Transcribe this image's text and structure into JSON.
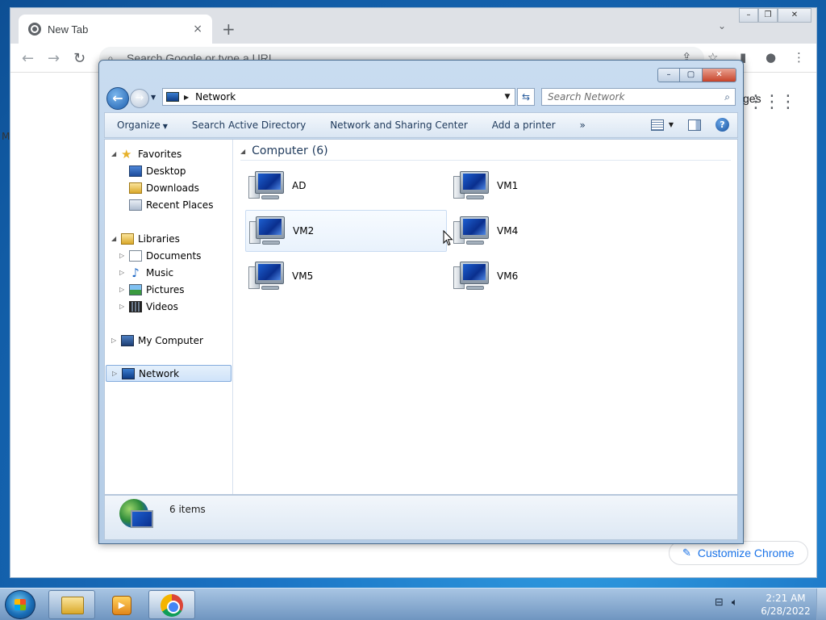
{
  "chrome": {
    "tab_title": "New Tab",
    "tab_close": "×",
    "new_tab": "+",
    "tab_search": "⌄",
    "omnibox_placeholder": "Search Google or type a URL",
    "images_link": "ges",
    "customize_label": "Customize Chrome",
    "left_edge_text": "M"
  },
  "explorer": {
    "address_crumb": "Network",
    "search_placeholder": "Search Network",
    "commands": [
      "Organize",
      "Search Active Directory",
      "Network and Sharing Center",
      "Add a printer",
      "»"
    ],
    "nav": {
      "favorites": "Favorites",
      "desktop": "Desktop",
      "downloads": "Downloads",
      "recent_places": "Recent Places",
      "libraries": "Libraries",
      "documents": "Documents",
      "music": "Music",
      "pictures": "Pictures",
      "videos": "Videos",
      "my_computer": "My Computer",
      "network": "Network"
    },
    "group": {
      "title": "Computer",
      "count": "(6)"
    },
    "computers": [
      "AD",
      "VM1",
      "VM2",
      "VM4",
      "VM5",
      "VM6"
    ],
    "status_count": "6 items"
  },
  "taskbar": {
    "time": "2:21 AM",
    "date": "6/28/2022"
  },
  "icons": {
    "chrome_tab": "chrome-favicon-icon",
    "start": "windows-start-icon",
    "folder": "folder-icon",
    "media": "media-player-icon",
    "browser": "chrome-icon",
    "network_tray": "network-tray-icon",
    "volume": "volume-icon"
  }
}
